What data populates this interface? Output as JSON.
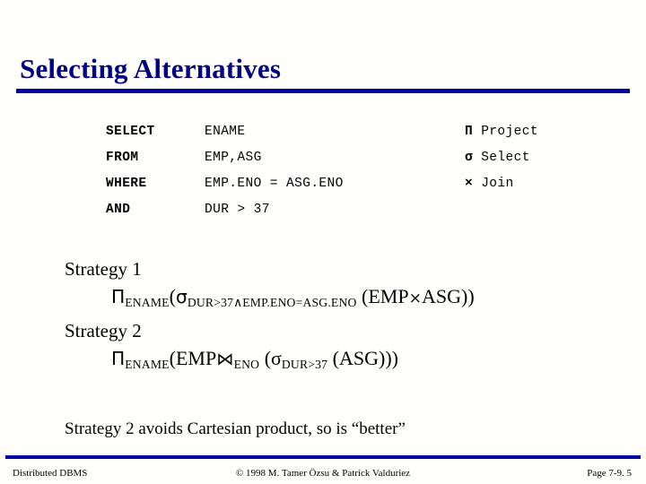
{
  "slide": {
    "title": "Selecting Alternatives",
    "accent_color": "#0000a0",
    "title_color": "#000080",
    "background_color": "#fffffe"
  },
  "query": {
    "rows": [
      {
        "keyword": "SELECT",
        "value": "ENAME"
      },
      {
        "keyword": "FROM",
        "value": "EMP,ASG"
      },
      {
        "keyword": "WHERE",
        "value": "EMP.ENO = ASG.ENO"
      },
      {
        "keyword": "AND",
        "value": "DUR > 37"
      }
    ]
  },
  "legend": {
    "items": [
      {
        "symbol": "Π",
        "label": " Project"
      },
      {
        "symbol": "σ",
        "label": " Select"
      },
      {
        "symbol": "×",
        "label": " Join"
      }
    ]
  },
  "strategies": [
    {
      "heading": "Strategy 1",
      "formula": {
        "pi": "Π",
        "pi_sub": "ENAME",
        "open1": "(",
        "sigma": "σ",
        "sigma_sub": "DUR>37∧EMP.ENO=ASG.ENO",
        "operand": " (EMP",
        "join_symbol": "×",
        "operand_tail": "ASG))"
      }
    },
    {
      "heading": "Strategy 2",
      "formula": {
        "pi": "Π",
        "pi_sub": "ENAME",
        "open1": "(EMP",
        "join_symbol": "⋈",
        "join_sub": "ENO",
        "sigma_open": " (σ",
        "sigma_sub": "DUR>37",
        "operand_tail": " (ASG)))"
      }
    }
  ],
  "conclusion": "Strategy 2 avoids Cartesian product, so is “better”",
  "footer": {
    "left": "Distributed DBMS",
    "center": "© 1998 M. Tamer Özsu & Patrick Valduriez",
    "right": "Page 7-9. 5"
  }
}
